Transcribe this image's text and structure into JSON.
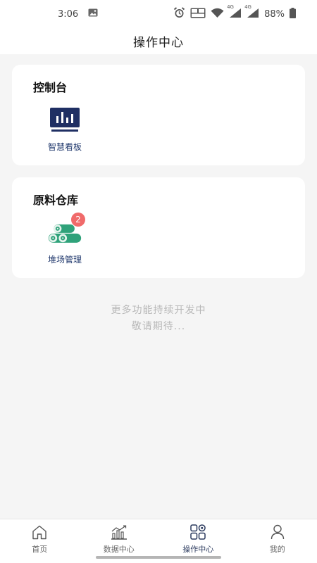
{
  "status_bar": {
    "time": "3:06",
    "battery_percent": "88%",
    "network_label_1": "4G",
    "network_label_2": "4G"
  },
  "header": {
    "title": "操作中心"
  },
  "sections": [
    {
      "title": "控制台",
      "items": [
        {
          "label": "智慧看板",
          "icon": "dashboard-monitor-icon"
        }
      ]
    },
    {
      "title": "原料仓库",
      "items": [
        {
          "label": "堆场管理",
          "icon": "log-pile-icon",
          "badge": "2"
        }
      ]
    }
  ],
  "notice": {
    "line1": "更多功能持续开发中",
    "line2": "敬请期待..."
  },
  "bottom_nav": [
    {
      "label": "首页",
      "icon": "home-icon",
      "active": false
    },
    {
      "label": "数据中心",
      "icon": "chart-icon",
      "active": false
    },
    {
      "label": "操作中心",
      "icon": "grid-apps-icon",
      "active": true
    },
    {
      "label": "我的",
      "icon": "user-icon",
      "active": false
    }
  ],
  "colors": {
    "primary": "#1f2f63",
    "badge": "#f06a6a",
    "log_green": "#2fa27a",
    "background": "#f5f5f5"
  }
}
